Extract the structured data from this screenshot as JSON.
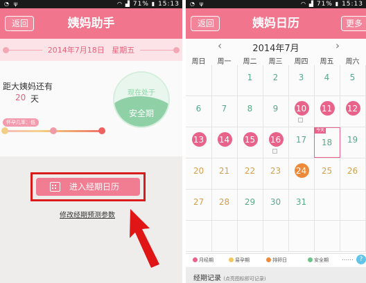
{
  "left": {
    "status": {
      "time": "15:13",
      "battery": "71%"
    },
    "header": {
      "back_label": "返回",
      "title": "姨妈助手"
    },
    "date_bar": {
      "date": "2014年7月18日",
      "weekday": "星期五"
    },
    "countdown": {
      "label": "距大姨妈还有",
      "days": "20",
      "unit": "天"
    },
    "pregnancy_tip": "怀孕几率：低",
    "progress_level": 0.5,
    "status_orb": {
      "line1": "现在处于",
      "line2": "安全期"
    },
    "calendar_button": {
      "label": "进入经期日历"
    },
    "modify_link": "修改经期预测参数"
  },
  "right": {
    "status": {
      "time": "15:13",
      "battery": "71%"
    },
    "header": {
      "back_label": "返回",
      "title": "姨妈日历",
      "more_label": "更多"
    },
    "month": "2014年7月",
    "weekdays": [
      "周日",
      "周一",
      "周二",
      "周三",
      "周四",
      "周五",
      "周六"
    ],
    "today_tag": "今天",
    "days": [
      {
        "d": "1",
        "col": 2,
        "row": 0,
        "type": "normal"
      },
      {
        "d": "2",
        "col": 3,
        "row": 0,
        "type": "normal"
      },
      {
        "d": "3",
        "col": 4,
        "row": 0,
        "type": "normal"
      },
      {
        "d": "4",
        "col": 5,
        "row": 0,
        "type": "normal"
      },
      {
        "d": "5",
        "col": 6,
        "row": 0,
        "type": "normal"
      },
      {
        "d": "6",
        "col": 0,
        "row": 1,
        "type": "normal"
      },
      {
        "d": "7",
        "col": 1,
        "row": 1,
        "type": "normal"
      },
      {
        "d": "8",
        "col": 2,
        "row": 1,
        "type": "normal"
      },
      {
        "d": "9",
        "col": 3,
        "row": 1,
        "type": "normal"
      },
      {
        "d": "10",
        "col": 4,
        "row": 1,
        "type": "period",
        "note": true
      },
      {
        "d": "11",
        "col": 5,
        "row": 1,
        "type": "period"
      },
      {
        "d": "12",
        "col": 6,
        "row": 1,
        "type": "period"
      },
      {
        "d": "13",
        "col": 0,
        "row": 2,
        "type": "period"
      },
      {
        "d": "14",
        "col": 1,
        "row": 2,
        "type": "period"
      },
      {
        "d": "15",
        "col": 2,
        "row": 2,
        "type": "period"
      },
      {
        "d": "16",
        "col": 3,
        "row": 2,
        "type": "period",
        "note": true
      },
      {
        "d": "17",
        "col": 4,
        "row": 2,
        "type": "normal"
      },
      {
        "d": "18",
        "col": 5,
        "row": 2,
        "type": "today"
      },
      {
        "d": "19",
        "col": 6,
        "row": 2,
        "type": "normal"
      },
      {
        "d": "20",
        "col": 0,
        "row": 3,
        "type": "fertile"
      },
      {
        "d": "21",
        "col": 1,
        "row": 3,
        "type": "fertile"
      },
      {
        "d": "22",
        "col": 2,
        "row": 3,
        "type": "fertile"
      },
      {
        "d": "23",
        "col": 3,
        "row": 3,
        "type": "fertile"
      },
      {
        "d": "24",
        "col": 4,
        "row": 3,
        "type": "ovulation"
      },
      {
        "d": "25",
        "col": 5,
        "row": 3,
        "type": "fertile"
      },
      {
        "d": "26",
        "col": 6,
        "row": 3,
        "type": "fertile"
      },
      {
        "d": "27",
        "col": 0,
        "row": 4,
        "type": "fertile"
      },
      {
        "d": "28",
        "col": 1,
        "row": 4,
        "type": "fertile"
      },
      {
        "d": "29",
        "col": 2,
        "row": 4,
        "type": "safe"
      },
      {
        "d": "30",
        "col": 3,
        "row": 4,
        "type": "safe"
      },
      {
        "d": "31",
        "col": 4,
        "row": 4,
        "type": "safe"
      }
    ],
    "legend": [
      {
        "label": "月经期",
        "color": "#e8628a"
      },
      {
        "label": "易孕期",
        "color": "#f2c75c"
      },
      {
        "label": "排卵日",
        "color": "#ee8b3a"
      },
      {
        "label": "安全期",
        "color": "#6cc48a"
      }
    ],
    "legend_more": "......",
    "record": {
      "title": "经期记录",
      "hint": "(点亮图标即可记录)"
    },
    "colors": {
      "normal": "#5aa88a",
      "period": "#e8628a",
      "fertile": "#d4a04c",
      "safe": "#5aa88a",
      "today_text": "#5aa88a"
    }
  }
}
